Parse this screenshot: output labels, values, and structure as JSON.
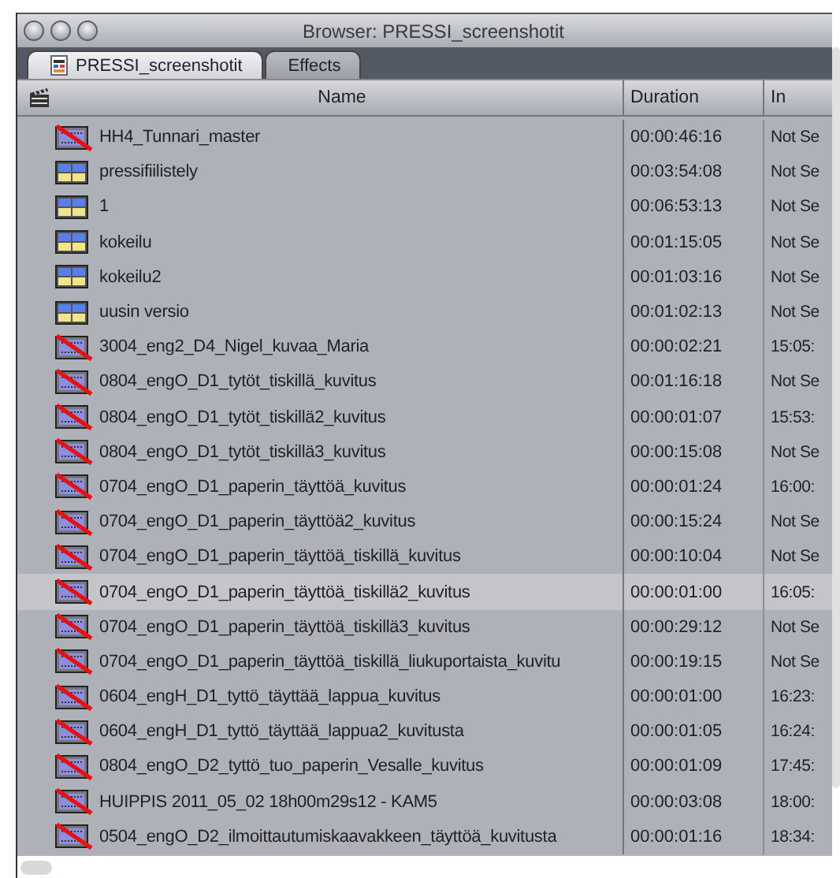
{
  "window": {
    "title": "Browser: PRESSI_screenshotit"
  },
  "tabs": [
    {
      "label": "PRESSI_screenshotit",
      "selected": true
    },
    {
      "label": "Effects",
      "selected": false
    }
  ],
  "table": {
    "columns": [
      "Name",
      "Duration",
      "In"
    ],
    "rows": [
      {
        "kind": "offline",
        "name": "HH4_Tunnari_master",
        "duration": "00:00:46:16",
        "in": "Not Se",
        "selected": false
      },
      {
        "kind": "sequence",
        "name": "pressifiilistely",
        "duration": "00:03:54:08",
        "in": "Not Se",
        "selected": false
      },
      {
        "kind": "sequence",
        "name": "1",
        "duration": "00:06:53:13",
        "in": "Not Se",
        "selected": false
      },
      {
        "kind": "sequence",
        "name": "kokeilu",
        "duration": "00:01:15:05",
        "in": "Not Se",
        "selected": false
      },
      {
        "kind": "sequence",
        "name": "kokeilu2",
        "duration": "00:01:03:16",
        "in": "Not Se",
        "selected": false
      },
      {
        "kind": "sequence",
        "name": "uusin versio",
        "duration": "00:01:02:13",
        "in": "Not Se",
        "selected": false
      },
      {
        "kind": "offline",
        "name": "3004_eng2_D4_Nigel_kuvaa_Maria",
        "duration": "00:00:02:21",
        "in": "15:05:",
        "selected": false
      },
      {
        "kind": "offline",
        "name": "0804_engO_D1_tytöt_tiskillä_kuvitus",
        "duration": "00:01:16:18",
        "in": "Not Se",
        "selected": false
      },
      {
        "kind": "offline",
        "name": "0804_engO_D1_tytöt_tiskillä2_kuvitus",
        "duration": "00:00:01:07",
        "in": "15:53:",
        "selected": false
      },
      {
        "kind": "offline",
        "name": "0804_engO_D1_tytöt_tiskillä3_kuvitus",
        "duration": "00:00:15:08",
        "in": "Not Se",
        "selected": false
      },
      {
        "kind": "offline",
        "name": "0704_engO_D1_paperin_täyttöä_kuvitus",
        "duration": "00:00:01:24",
        "in": "16:00:",
        "selected": false
      },
      {
        "kind": "offline",
        "name": "0704_engO_D1_paperin_täyttöä2_kuvitus",
        "duration": "00:00:15:24",
        "in": "Not Se",
        "selected": false
      },
      {
        "kind": "offline",
        "name": "0704_engO_D1_paperin_täyttöä_tiskillä_kuvitus",
        "duration": "00:00:10:04",
        "in": "Not Se",
        "selected": false
      },
      {
        "kind": "offline",
        "name": "0704_engO_D1_paperin_täyttöä_tiskillä2_kuvitus",
        "duration": "00:00:01:00",
        "in": "16:05:",
        "selected": true
      },
      {
        "kind": "offline",
        "name": "0704_engO_D1_paperin_täyttöä_tiskillä3_kuvitus",
        "duration": "00:00:29:12",
        "in": "Not Se",
        "selected": false
      },
      {
        "kind": "offline",
        "name": "0704_engO_D1_paperin_täyttöä_tiskillä_liukuportaista_kuvitu",
        "duration": "00:00:19:15",
        "in": "Not Se",
        "selected": false
      },
      {
        "kind": "offline",
        "name": "0604_engH_D1_tyttö_täyttää_lappua_kuvitus",
        "duration": "00:00:01:00",
        "in": "16:23:",
        "selected": false
      },
      {
        "kind": "offline",
        "name": "0604_engH_D1_tyttö_täyttää_lappua2_kuvitusta",
        "duration": "00:00:01:05",
        "in": "16:24:",
        "selected": false
      },
      {
        "kind": "offline",
        "name": "0804_engO_D2_tyttö_tuo_paperin_Vesalle_kuvitus",
        "duration": "00:00:01:09",
        "in": "17:45:",
        "selected": false
      },
      {
        "kind": "offline",
        "name": "HUIPPIS 2011_05_02 18h00m29s12 - KAM5",
        "duration": "00:00:03:08",
        "in": "18:00:",
        "selected": false
      },
      {
        "kind": "offline",
        "name": "0504_engO_D2_ilmoittautumiskaavakkeen_täyttöä_kuvitusta",
        "duration": "00:00:01:16",
        "in": "18:34:",
        "selected": false
      }
    ]
  }
}
